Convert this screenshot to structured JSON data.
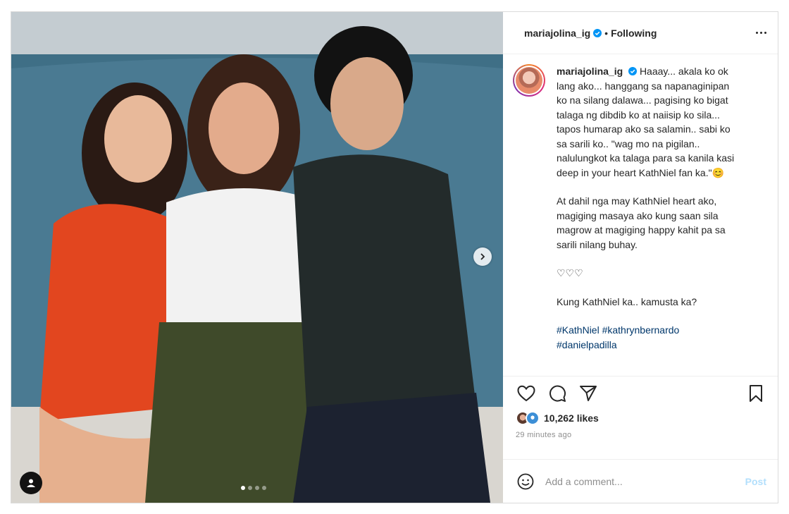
{
  "post": {
    "username": "mariajolina_ig",
    "separator": "•",
    "follow_status": "Following",
    "caption": {
      "username": "mariajolina_ig",
      "paragraph1": "Haaay... akala ko ok lang ako... hanggang sa napanaginipan ko na silang dalawa... pagising ko bigat talaga ng dibdib ko at naiisip ko sila... tapos humarap ako sa salamin.. sabi ko sa sarili ko.. \"wag mo na pigilan.. nalulungkot ka talaga para sa kanila kasi deep in your heart KathNiel fan ka.\"",
      "emoji": "😊",
      "paragraph2": "At dahil nga may KathNiel heart ako, magiging masaya ako kung saan sila magrow at magiging happy kahit pa sa sarili nilang buhay.",
      "hearts": "♡♡♡",
      "paragraph3": "Kung KathNiel ka.. kamusta ka?",
      "hashtags": [
        "#KathNiel",
        "#kathrynbernardo",
        "#danielpadilla"
      ]
    },
    "likes": "10,262 likes",
    "time_ago": "29 minutes ago",
    "comment_placeholder": "Add a comment...",
    "post_button": "Post",
    "carousel": {
      "total": 4,
      "active": 1
    }
  },
  "icons": {
    "verified": "verified-badge-icon",
    "more": "more-options-icon",
    "like": "heart-icon",
    "comment": "comment-icon",
    "share": "share-icon",
    "save": "bookmark-icon",
    "emoji": "emoji-icon",
    "next": "chevron-right-icon",
    "tag": "user-tag-icon"
  },
  "colors": {
    "text": "#262626",
    "muted": "#8e8e8e",
    "verified": "#0095f6",
    "hashtag": "#00376b",
    "post_disabled": "#b2dffc"
  }
}
